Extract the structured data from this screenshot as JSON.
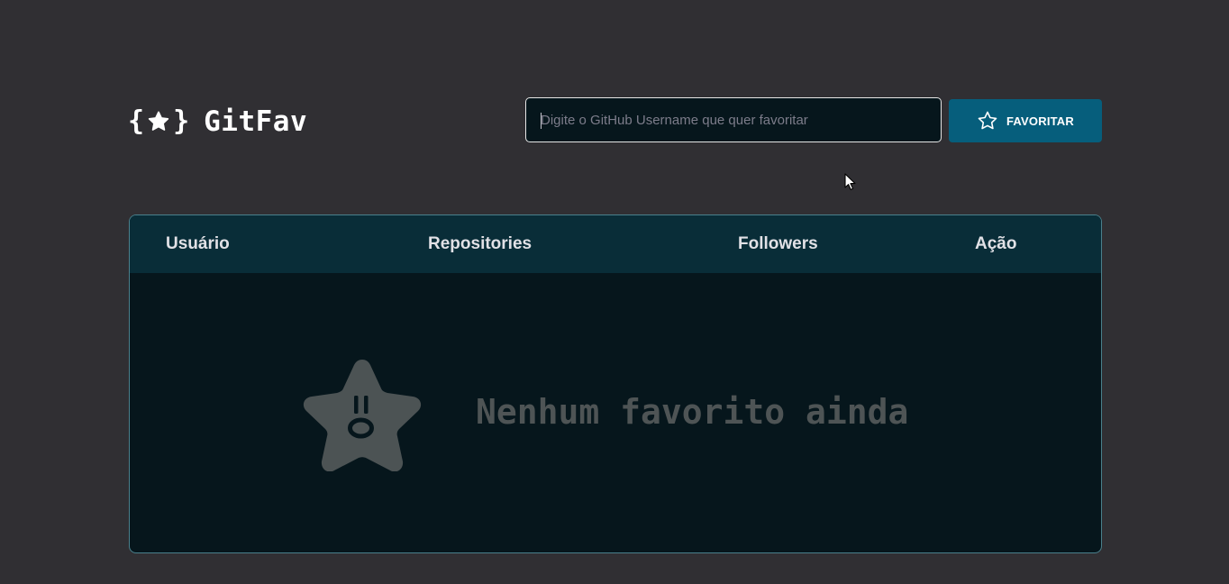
{
  "header": {
    "logo_text": "GitFav",
    "search": {
      "placeholder": "Digite o GitHub Username que quer favoritar",
      "value": ""
    },
    "favorite_button_label": "FAVORITAR"
  },
  "table": {
    "columns": [
      "Usuário",
      "Repositories",
      "Followers",
      "Ação"
    ],
    "rows": [],
    "empty_message": "Nenhum favorito ainda"
  },
  "icons": {
    "logo": "star-in-braces-icon",
    "button": "star-outline-icon",
    "empty_state": "surprised-star-icon"
  },
  "colors": {
    "background": "#302f33",
    "button": "#065e7c",
    "table_header": "#092d38",
    "table_body": "#06161c",
    "muted_text": "#4e5455"
  }
}
